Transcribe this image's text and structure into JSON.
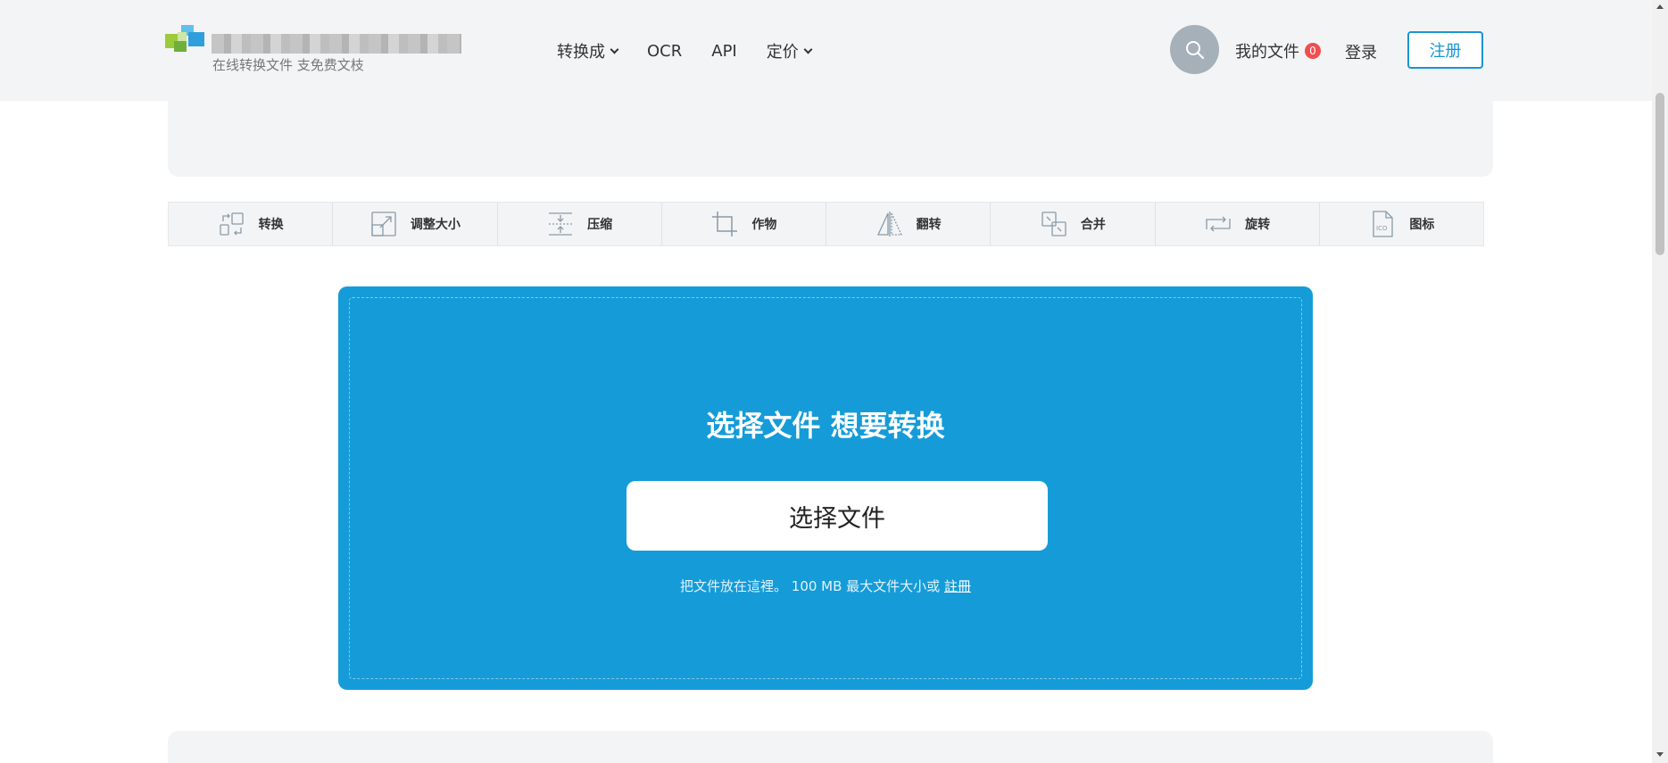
{
  "header": {
    "logo_subtitle": "在线转换文件 支免费文枝",
    "nav": [
      {
        "label": "转换成",
        "dropdown": true
      },
      {
        "label": "OCR",
        "dropdown": false
      },
      {
        "label": "API",
        "dropdown": false
      },
      {
        "label": "定价",
        "dropdown": true
      }
    ],
    "search_icon": "search-icon",
    "my_files_label": "我的文件",
    "my_files_count": "0",
    "login_label": "登录",
    "register_label": "注册"
  },
  "toolbar": {
    "items": [
      {
        "label": "转换",
        "icon": "convert-icon"
      },
      {
        "label": "调整大小",
        "icon": "resize-icon"
      },
      {
        "label": "压缩",
        "icon": "compress-icon"
      },
      {
        "label": "作物",
        "icon": "crop-icon"
      },
      {
        "label": "翻转",
        "icon": "flip-icon"
      },
      {
        "label": "合并",
        "icon": "merge-icon"
      },
      {
        "label": "旋转",
        "icon": "rotate-icon"
      },
      {
        "label": "图标",
        "icon": "ico-icon"
      }
    ]
  },
  "upload": {
    "title": "选择文件 想要转换",
    "button_label": "选择文件",
    "hint_text": "把文件放在這裡。 100 MB 最大文件大小或",
    "hint_link": "註冊"
  },
  "colors": {
    "brand_blue": "#159cd8",
    "register_border": "#1795d4",
    "badge_red": "#f04e4e",
    "header_bg": "#f3f4f5"
  }
}
